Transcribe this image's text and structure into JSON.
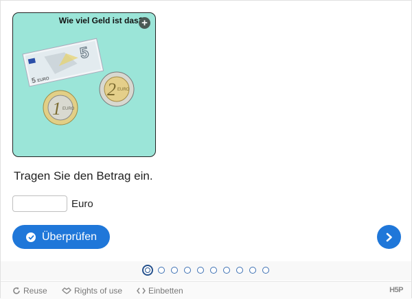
{
  "card": {
    "title": "Wie viel Geld ist das?",
    "expand_icon": "plus-icon",
    "banknote_denomination": "5",
    "banknote_currency": "EURO",
    "coins": [
      "1",
      "2"
    ],
    "coin_currency": "EURO"
  },
  "task": {
    "text": "Tragen Sie den Betrag ein."
  },
  "answer": {
    "value": "",
    "placeholder": "",
    "unit": "Euro"
  },
  "buttons": {
    "check_label": "Überprüfen",
    "check_icon": "check-icon",
    "next_icon": "chevron-right-icon"
  },
  "pagination": {
    "total": 10,
    "current": 1
  },
  "footer": {
    "reuse": "Reuse",
    "rights": "Rights of use",
    "embed": "Einbetten",
    "brand": "H5P"
  },
  "colors": {
    "card_bg": "#9be5d8",
    "accent": "#1f77d9",
    "dot": "#3b6fb2"
  }
}
